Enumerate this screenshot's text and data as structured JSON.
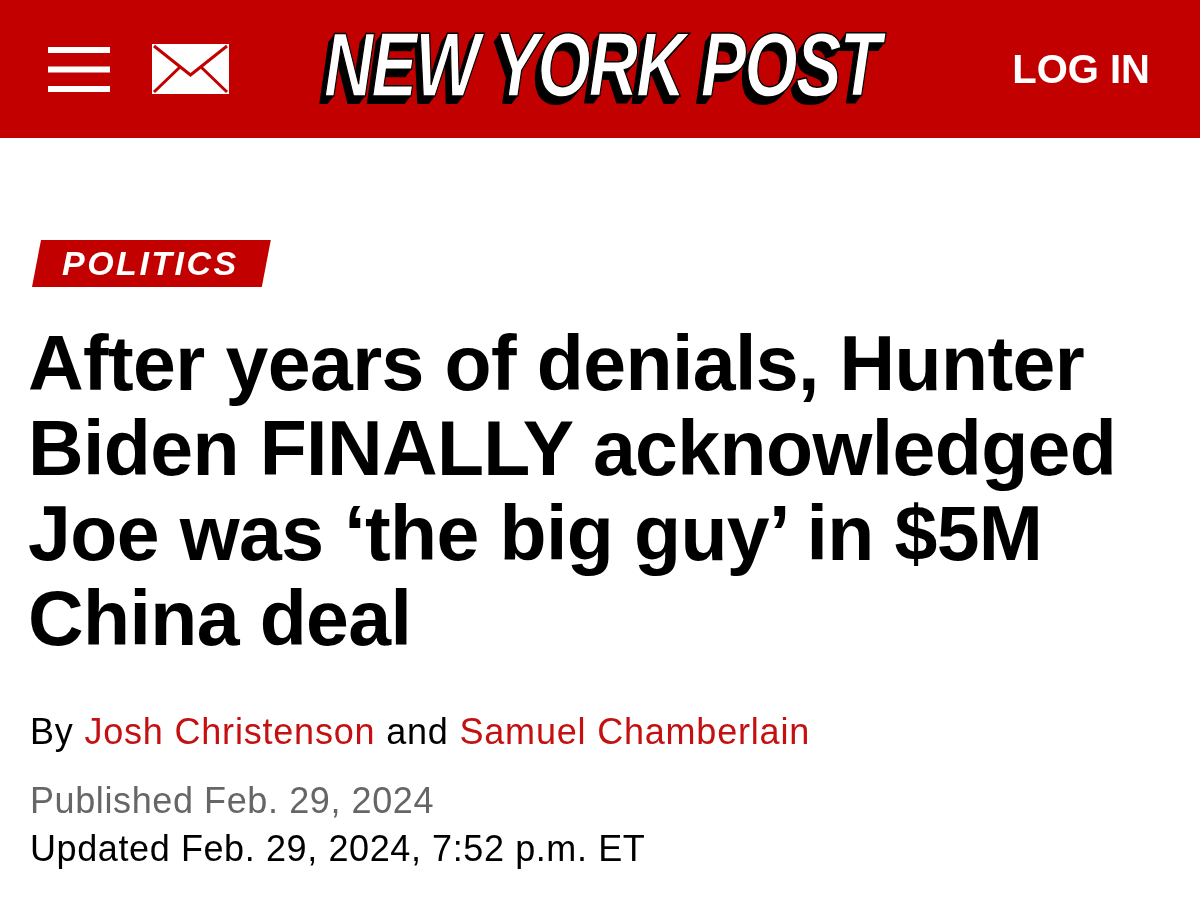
{
  "header": {
    "logo": "NEW YORK POST",
    "login": "LOG IN"
  },
  "article": {
    "section": "POLITICS",
    "headline": "After years of denials, Hunter Biden FINALLY acknowledged Joe was ‘the big guy’ in $5M China deal",
    "byline": {
      "prefix": "By",
      "authors": [
        "Josh Christenson",
        "Samuel Chamberlain"
      ],
      "joiner": "and"
    },
    "published": "Published Feb. 29, 2024",
    "updated": "Updated Feb. 29, 2024, 7:52 p.m. ET"
  }
}
